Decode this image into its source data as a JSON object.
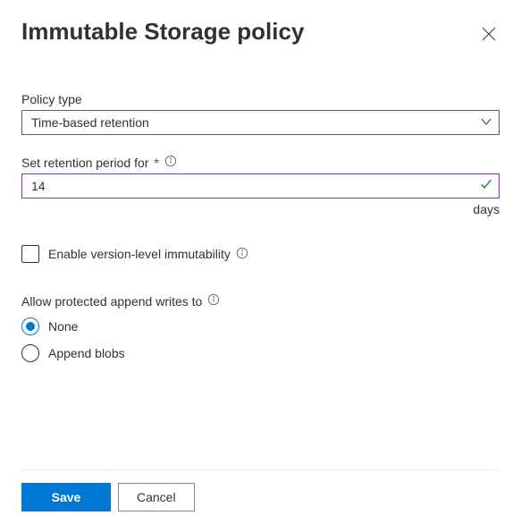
{
  "header": {
    "title": "Immutable Storage policy"
  },
  "policyType": {
    "label": "Policy type",
    "selected": "Time-based retention"
  },
  "retention": {
    "label": "Set retention period for",
    "value": "14",
    "unit": "days"
  },
  "versionLevel": {
    "label": "Enable version-level immutability",
    "checked": false
  },
  "appendWrites": {
    "label": "Allow protected append writes to",
    "options": [
      {
        "label": "None",
        "selected": true
      },
      {
        "label": "Append blobs",
        "selected": false
      }
    ]
  },
  "footer": {
    "save": "Save",
    "cancel": "Cancel"
  }
}
